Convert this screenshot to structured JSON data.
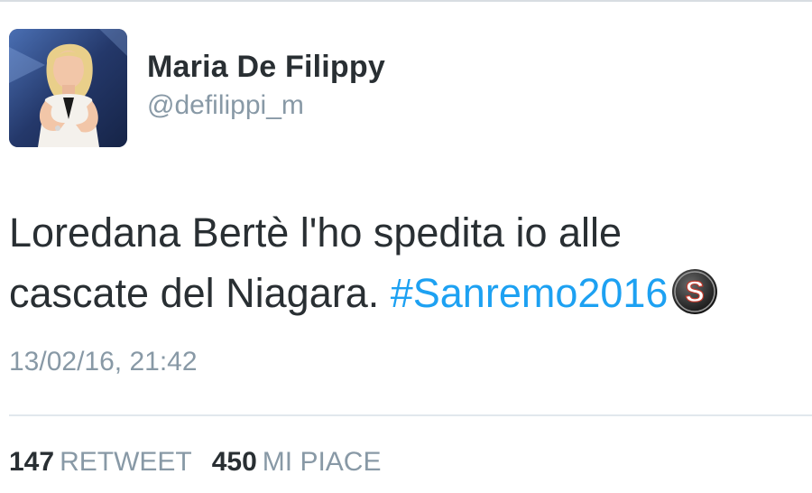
{
  "tweet": {
    "author": {
      "display_name": "Maria De Filippy",
      "handle": "@defilippi_m"
    },
    "text_line_1": "Loredana Bertè l'ho spedita io alle",
    "text_line_2": "cascate del Niagara. ",
    "hashtag": "#Sanremo2016",
    "emoji_icon": "s-logo-icon",
    "timestamp": "13/02/16, 21:42",
    "stats": {
      "retweet_count": "147",
      "retweet_label": "RETWEET",
      "like_count": "450",
      "like_label": "MI PIACE"
    }
  },
  "colors": {
    "text": "#292f33",
    "secondary": "#8899a6",
    "hashtag": "#1da1f2",
    "divider": "#e1e8ed"
  }
}
